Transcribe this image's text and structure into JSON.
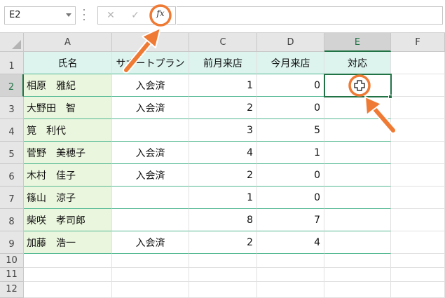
{
  "formula_bar": {
    "name_box": "E2",
    "cancel_icon": "close-icon",
    "enter_icon": "check-icon",
    "fx_label": "fx",
    "formula": ""
  },
  "columns": [
    "A",
    "B",
    "C",
    "D",
    "E",
    "F"
  ],
  "rows": [
    "1",
    "2",
    "3",
    "4",
    "5",
    "6",
    "7",
    "8",
    "9",
    "10",
    "11",
    "12"
  ],
  "table": {
    "headers": [
      "氏名",
      "サポートプラン",
      "前月来店",
      "今月来店",
      "対応"
    ],
    "rows": [
      [
        "相原　雅紀",
        "入会済",
        "1",
        "0",
        ""
      ],
      [
        "大野田　智",
        "入会済",
        "2",
        "0",
        ""
      ],
      [
        "筧　利代",
        "",
        "3",
        "5",
        ""
      ],
      [
        "菅野　美穂子",
        "入会済",
        "4",
        "1",
        ""
      ],
      [
        "木村　佳子",
        "入会済",
        "2",
        "0",
        ""
      ],
      [
        "篠山　涼子",
        "",
        "1",
        "0",
        ""
      ],
      [
        "柴咲　孝司郎",
        "",
        "8",
        "7",
        ""
      ],
      [
        "加藤　浩一",
        "入会済",
        "2",
        "4",
        ""
      ]
    ]
  },
  "selection": {
    "cell": "E2"
  },
  "colors": {
    "accent": "#217346",
    "annotation": "#ef7a34",
    "header_fill": "#dcf3ee",
    "name_fill": "#ebf6de"
  }
}
